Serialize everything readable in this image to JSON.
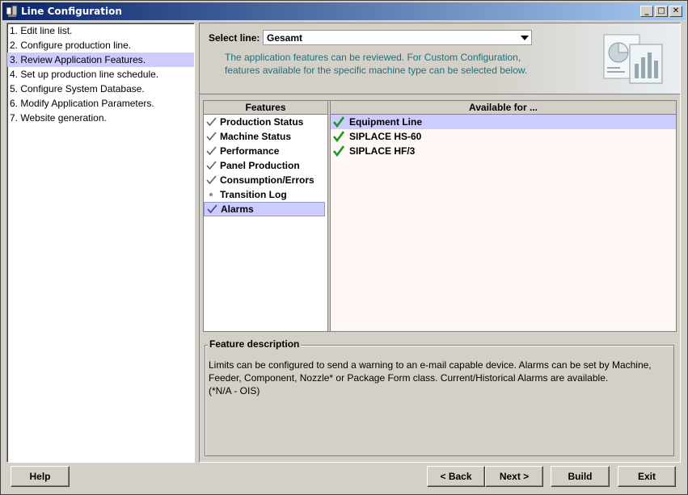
{
  "window": {
    "title": "Line Configuration",
    "controls": {
      "minimize": "_",
      "maximize": "□",
      "close": "✕"
    }
  },
  "steps": [
    {
      "label": "1. Edit line list.",
      "active": false
    },
    {
      "label": "2. Configure production line.",
      "active": false
    },
    {
      "label": "3. Review Application Features.",
      "active": true
    },
    {
      "label": "4. Set up production line schedule.",
      "active": false
    },
    {
      "label": "5. Configure System Database.",
      "active": false
    },
    {
      "label": "6. Modify Application Parameters.",
      "active": false
    },
    {
      "label": "7. Website generation.",
      "active": false
    }
  ],
  "header": {
    "select_label": "Select line:",
    "selected_line": "Gesamt",
    "info": "The application features can be reviewed. For Custom Configuration, features available for the specific machine type can be selected below."
  },
  "features": {
    "header": "Features",
    "items": [
      {
        "label": "Production Status",
        "mark": "check"
      },
      {
        "label": "Machine Status",
        "mark": "check"
      },
      {
        "label": "Performance",
        "mark": "check"
      },
      {
        "label": "Panel Production",
        "mark": "check"
      },
      {
        "label": "Consumption/Errors",
        "mark": "check"
      },
      {
        "label": "Transition Log",
        "mark": "dot"
      },
      {
        "label": "Alarms",
        "mark": "check",
        "active": true
      }
    ]
  },
  "available": {
    "header": "Available for ...",
    "items": [
      {
        "label": "Equipment Line",
        "active": true
      },
      {
        "label": "SIPLACE HS-60",
        "active": false
      },
      {
        "label": "SIPLACE HF/3",
        "active": false
      }
    ]
  },
  "description": {
    "title": "Feature description",
    "line1": "Limits can be configured to send a warning to an e-mail capable device. Alarms can be set by Machine,",
    "line2": "Feeder, Component, Nozzle* or Package Form class. Current/Historical Alarms are available.",
    "line3": "(*N/A - OIS)"
  },
  "buttons": {
    "help": "Help",
    "back": "< Back",
    "next": "Next >",
    "build": "Build",
    "exit": "Exit"
  },
  "colors": {
    "selection": "#ccccff",
    "info_text": "#1f6f7f",
    "check_green": "#1a9a1a",
    "titlebar_start": "#0a246a"
  }
}
